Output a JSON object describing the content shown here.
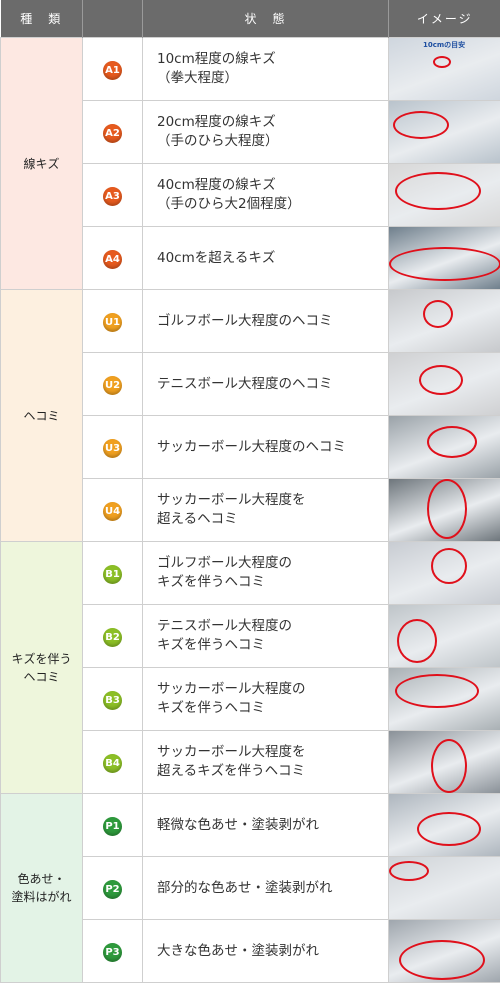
{
  "header": {
    "kind": "種　類",
    "state": "状　態",
    "image": "イメージ"
  },
  "colors": {
    "header_bg": "#6b6b6b",
    "a_badge": "#e65a1e",
    "u_badge": "#f0a020",
    "b_badge": "#8cbf26",
    "p_badge": "#2e9a3c",
    "a_bg": "#fde8e2",
    "u_bg": "#fdf0e0",
    "b_bg": "#eef6dc",
    "p_bg": "#e3f3e6"
  },
  "groups": [
    {
      "label": "線キズ",
      "rows": [
        {
          "code": "A1",
          "desc1": "10cm程度の線キズ",
          "desc2": "（拳大程度）",
          "img_label": "10cmの目安"
        },
        {
          "code": "A2",
          "desc1": "20cm程度の線キズ",
          "desc2": "（手のひら大程度）"
        },
        {
          "code": "A3",
          "desc1": "40cm程度の線キズ",
          "desc2": "（手のひら大2個程度）"
        },
        {
          "code": "A4",
          "desc1": "40cmを超えるキズ",
          "desc2": ""
        }
      ]
    },
    {
      "label": "ヘコミ",
      "rows": [
        {
          "code": "U1",
          "desc1": "ゴルフボール大程度のヘコミ",
          "desc2": ""
        },
        {
          "code": "U2",
          "desc1": "テニスボール大程度のヘコミ",
          "desc2": ""
        },
        {
          "code": "U3",
          "desc1": "サッカーボール大程度のヘコミ",
          "desc2": ""
        },
        {
          "code": "U4",
          "desc1": "サッカーボール大程度を",
          "desc2": "超えるヘコミ"
        }
      ]
    },
    {
      "label": "キズを伴う\nヘコミ",
      "rows": [
        {
          "code": "B1",
          "desc1": "ゴルフボール大程度の",
          "desc2": "キズを伴うヘコミ"
        },
        {
          "code": "B2",
          "desc1": "テニスボール大程度の",
          "desc2": "キズを伴うヘコミ"
        },
        {
          "code": "B3",
          "desc1": "サッカーボール大程度の",
          "desc2": "キズを伴うヘコミ"
        },
        {
          "code": "B4",
          "desc1": "サッカーボール大程度を",
          "desc2": "超えるキズを伴うヘコミ"
        }
      ]
    },
    {
      "label": "色あせ・\n塗料はがれ",
      "rows": [
        {
          "code": "P1",
          "desc1": "軽微な色あせ・塗装剥がれ",
          "desc2": ""
        },
        {
          "code": "P2",
          "desc1": "部分的な色あせ・塗装剥がれ",
          "desc2": ""
        },
        {
          "code": "P3",
          "desc1": "大きな色あせ・塗装剥がれ",
          "desc2": ""
        }
      ]
    }
  ]
}
